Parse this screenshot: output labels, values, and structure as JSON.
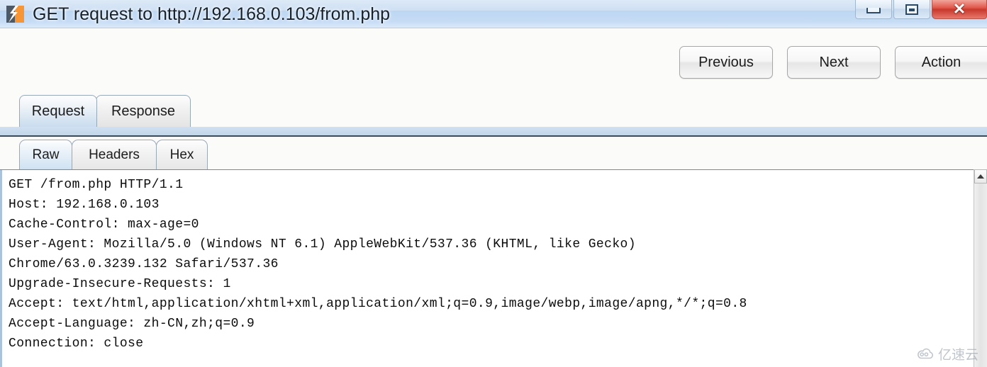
{
  "window": {
    "title": "GET request to http://192.168.0.103/from.php",
    "icon": "burp-suite-logo",
    "controls": {
      "minimize": "minimize-icon",
      "restore": "restore-icon",
      "close": "close-icon",
      "close_glyph": "✕"
    },
    "background_blur_hints": [
      "",
      "",
      "",
      "",
      ""
    ]
  },
  "toolbar": {
    "buttons": [
      {
        "label": "Previous",
        "name": "previous-button"
      },
      {
        "label": "Next",
        "name": "next-button"
      },
      {
        "label": "Action",
        "name": "action-button"
      }
    ]
  },
  "message_tabs": {
    "selected": "Request",
    "items": [
      {
        "label": "Request",
        "selected": true
      },
      {
        "label": "Response",
        "selected": false
      }
    ]
  },
  "view_tabs": {
    "selected": "Raw",
    "items": [
      {
        "label": "Raw",
        "selected": true
      },
      {
        "label": "Headers",
        "selected": false
      },
      {
        "label": "Hex",
        "selected": false
      }
    ]
  },
  "editor": {
    "content": "GET /from.php HTTP/1.1\nHost: 192.168.0.103\nCache-Control: max-age=0\nUser-Agent: Mozilla/5.0 (Windows NT 6.1) AppleWebKit/537.36 (KHTML, like Gecko)\nChrome/63.0.3239.132 Safari/537.36\nUpgrade-Insecure-Requests: 1\nAccept: text/html,application/xhtml+xml,application/xml;q=0.9,image/webp,image/apng,*/*;q=0.8\nAccept-Language: zh-CN,zh;q=0.9\nConnection: close"
  },
  "scrollbar": {
    "up_arrow": "scroll-up-icon"
  },
  "watermark": {
    "text": "亿速云",
    "icon": "cloud-icon"
  },
  "colors": {
    "accent": "#c9dcee",
    "titlebar": "#c6dcf5",
    "close": "#d0402f",
    "logo_orange": "#f79433"
  }
}
